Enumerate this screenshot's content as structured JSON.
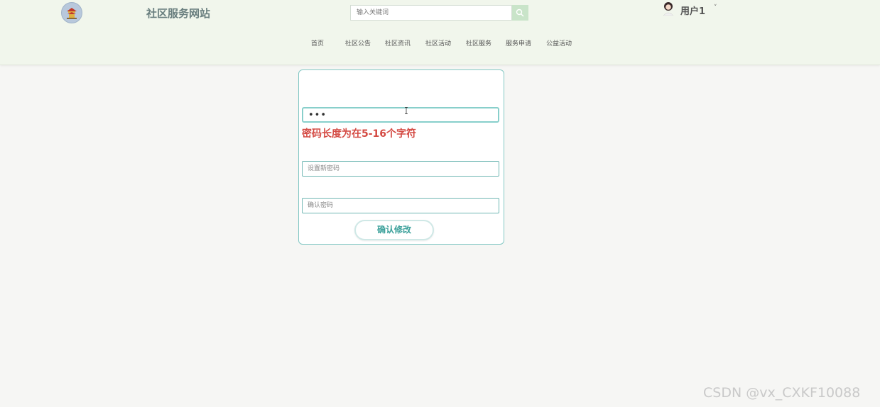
{
  "header": {
    "site_title": "社区服务网站",
    "logo_icon": "temple-logo-icon",
    "search": {
      "placeholder": "输入关键词",
      "value": "",
      "icon": "search-icon"
    },
    "user": {
      "name": "用户1",
      "caret": "˅",
      "avatar_icon": "user-avatar-icon"
    }
  },
  "nav": {
    "items": [
      {
        "label": "首页"
      },
      {
        "label": "社区公告"
      },
      {
        "label": "社区资讯"
      },
      {
        "label": "社区活动"
      },
      {
        "label": "社区服务"
      },
      {
        "label": "服务申请"
      },
      {
        "label": "公益活动"
      }
    ]
  },
  "form": {
    "old_password": {
      "value": "•••",
      "placeholder": ""
    },
    "error_text": "密码长度为在5-16个字符",
    "new_password": {
      "value": "",
      "placeholder": "设置新密码"
    },
    "confirm_password": {
      "value": "",
      "placeholder": "确认密码"
    },
    "submit_label": "确认修改"
  },
  "watermark": "CSDN @vx_CXKF10088",
  "colors": {
    "header_bg": "#f1f6ec",
    "accent": "#3aa09a",
    "border": "#84c8c4",
    "error": "#d44a43",
    "search_button": "#c9e4c9"
  }
}
